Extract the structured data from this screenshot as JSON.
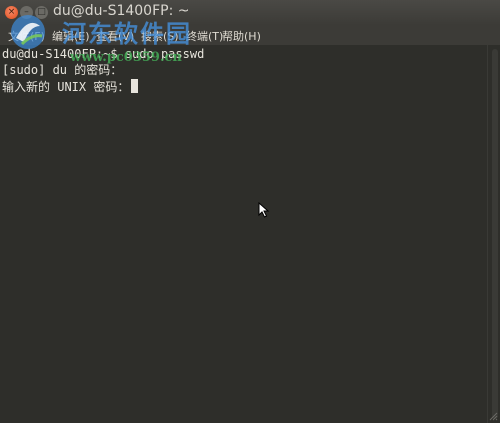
{
  "window": {
    "title": "du@du-S1400FP: ~",
    "close_glyph": "×",
    "min_glyph": "–",
    "max_glyph": "□"
  },
  "menu": {
    "items": [
      "文件(F)",
      "编辑(E)",
      "查看(V)",
      "搜索(S)",
      "终端(T)",
      "帮助(H)"
    ]
  },
  "terminal": {
    "lines": [
      "du@du-S1400FP:~$ sudo passwd",
      "[sudo] du 的密码：",
      "输入新的 UNIX 密码："
    ],
    "colors": {
      "background": "#2e2e2a",
      "foreground": "#e7e4dc"
    }
  },
  "watermark": {
    "title": "河东软件园",
    "url": "www.pc0359.cn"
  },
  "colors": {
    "titlebar": "#3c3b37",
    "close_button": "#df4a16"
  },
  "icons": {
    "close": "close-icon",
    "minimize": "minimize-icon",
    "maximize": "maximize-icon",
    "mouse": "mouse-pointer-icon",
    "watermark_logo": "watermark-logo-icon"
  }
}
